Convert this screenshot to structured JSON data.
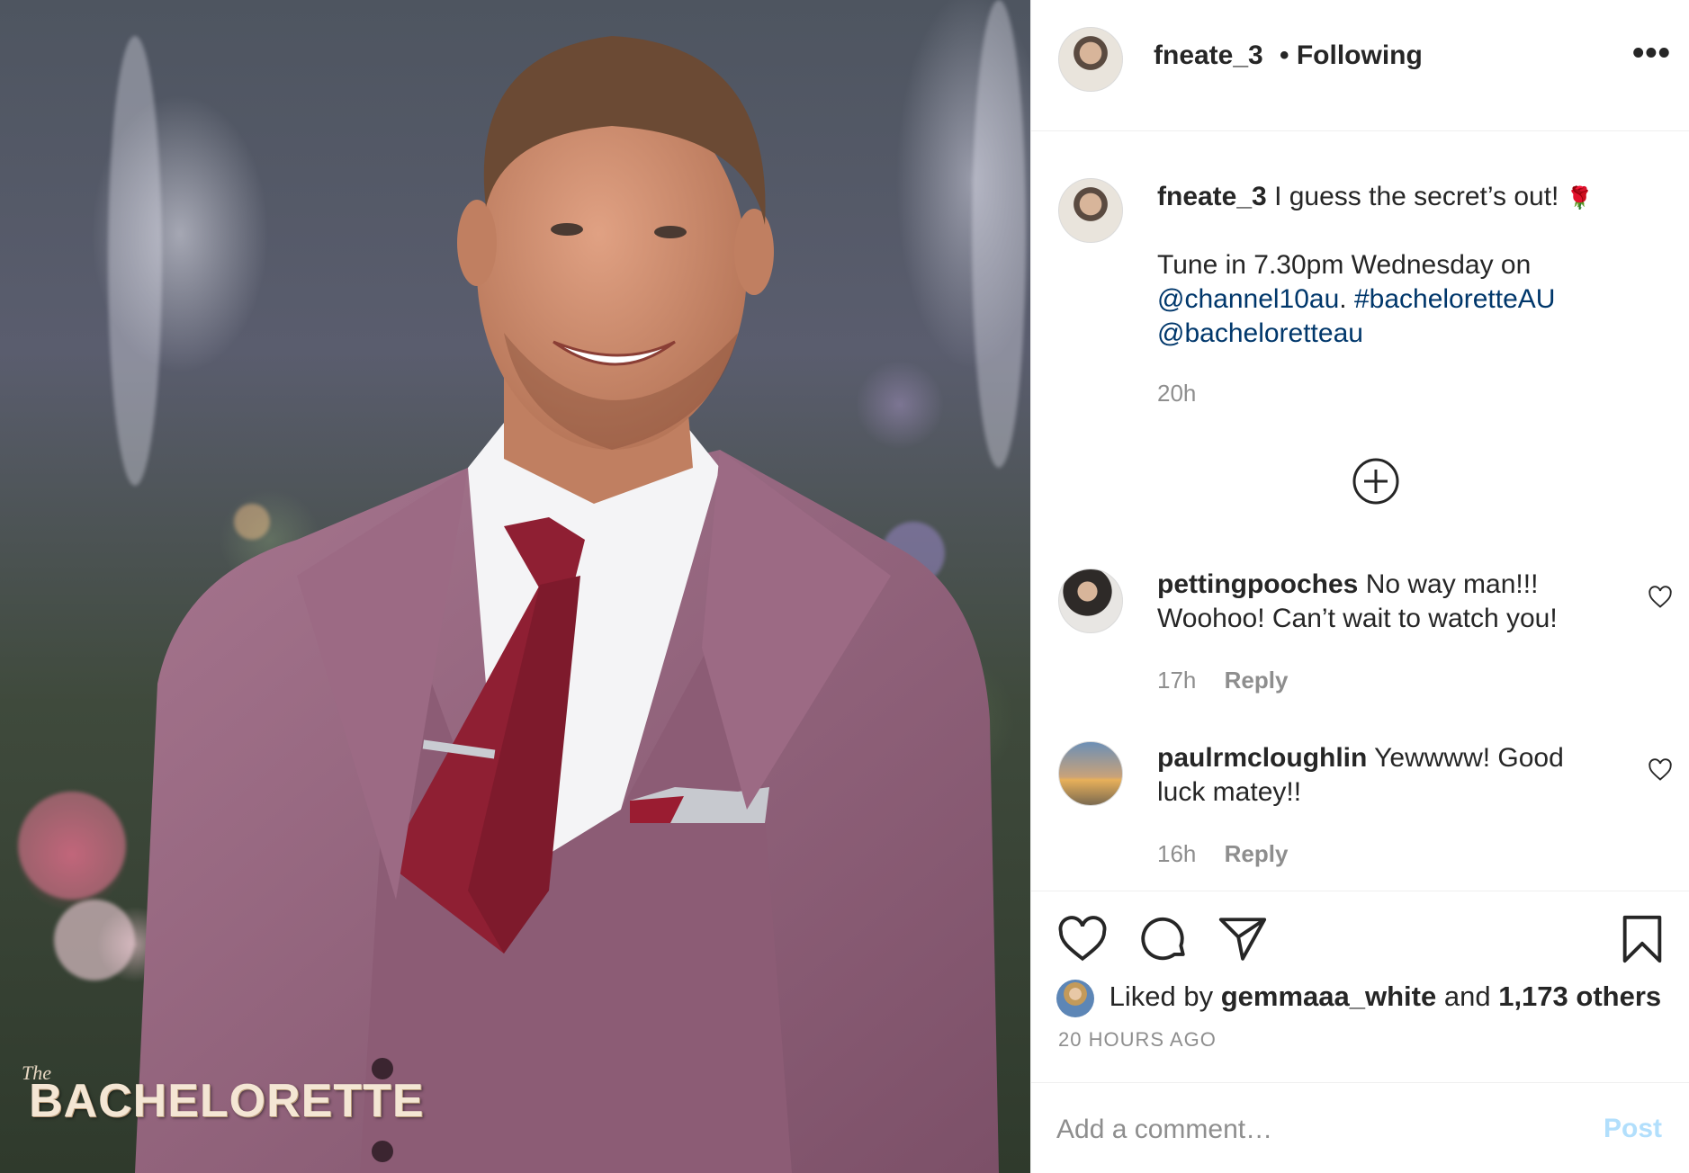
{
  "photo": {
    "brand_small": "The",
    "brand_word": "BACHELORETTE"
  },
  "post": {
    "author": "fneate_3",
    "follow_separator": "•",
    "follow_status": "Following",
    "more_glyph": "•••",
    "caption_line1": "I guess the secret’s out!",
    "caption_emoji": "🌹",
    "caption_line2": "Tune in 7.30pm Wednesday on",
    "mention_1": "@channel10au",
    "caption_dot": ".",
    "hashtag": "#bacheloretteAU",
    "mention_2": "@bacheloretteau",
    "age": "20h"
  },
  "comments": [
    {
      "user": "pettingpooches",
      "text_line1": "No way man!!!",
      "text_line2": "Woohoo! Can’t wait to watch you!",
      "age": "17h",
      "reply_label": "Reply"
    },
    {
      "user": "paulrmcloughlin",
      "text_line1": "Yewwww! Good",
      "text_line2": "luck matey!!",
      "age": "16h",
      "reply_label": "Reply"
    }
  ],
  "likes": {
    "prefix": "Liked by",
    "user": "gemmaaa_white",
    "joiner": "and",
    "others": "1,173 others",
    "timestamp": "20 HOURS AGO"
  },
  "composer": {
    "placeholder": "Add a comment…",
    "post_label": "Post"
  },
  "colors": {
    "link": "#00376b",
    "muted": "#8e8e8e",
    "post_disabled": "#b2dffc"
  },
  "icons": [
    "more-options-icon",
    "load-more-comments-icon",
    "like-comment-icon",
    "heart-icon",
    "comment-icon",
    "share-icon",
    "bookmark-icon"
  ]
}
